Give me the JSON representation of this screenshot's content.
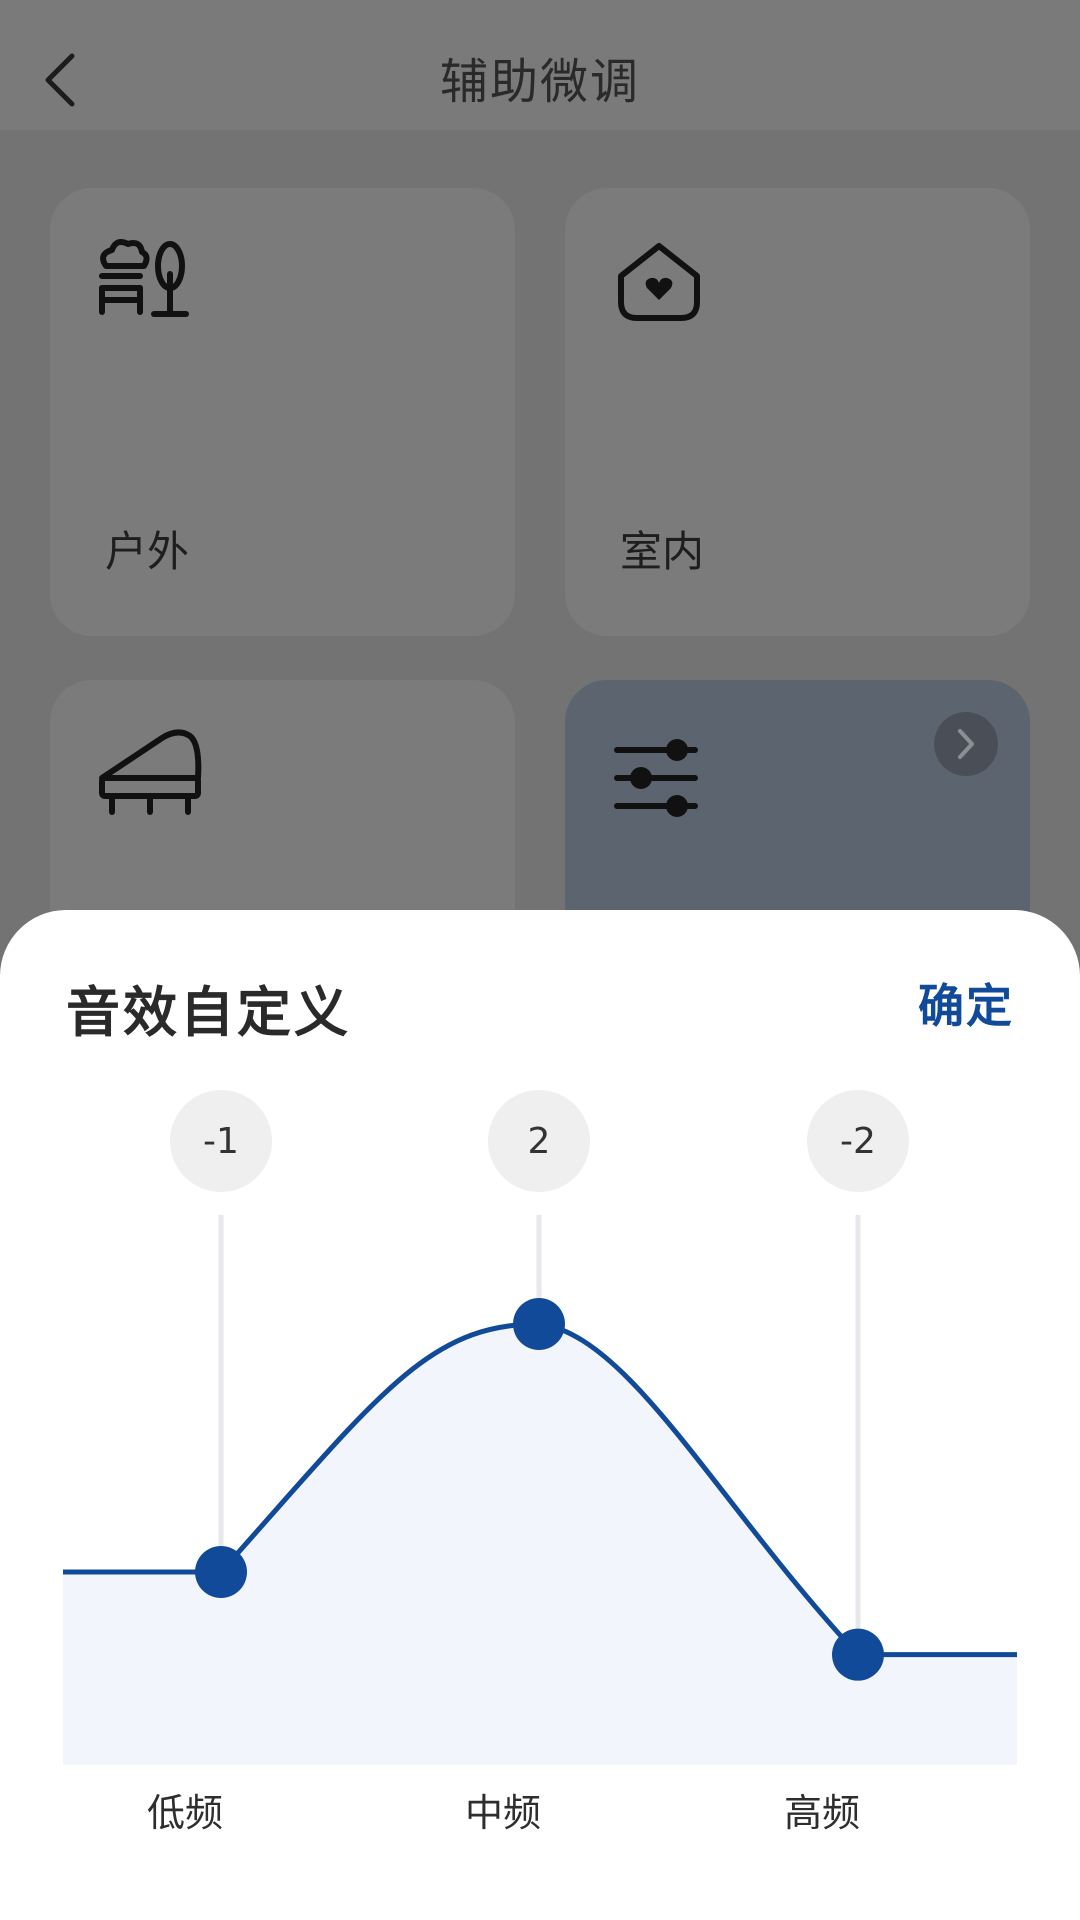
{
  "header": {
    "title": "辅助微调",
    "back_icon": "chevron-left-icon"
  },
  "cards": [
    {
      "label": "户外",
      "icon": "outdoor-bench-tree-icon"
    },
    {
      "label": "室内",
      "icon": "home-heart-icon"
    },
    {
      "label": "",
      "icon": "piano-icon"
    },
    {
      "label": "",
      "icon": "sliders-icon",
      "selected": true,
      "arrow_icon": "chevron-right-icon"
    }
  ],
  "sheet": {
    "title": "音效自定义",
    "confirm_label": "确定"
  },
  "equalizer": {
    "accent": "#104a99",
    "bands": [
      {
        "label": "低频",
        "value": -1,
        "value_text": "-1"
      },
      {
        "label": "中频",
        "value": 2,
        "value_text": "2"
      },
      {
        "label": "高频",
        "value": -2,
        "value_text": "-2"
      }
    ],
    "range": [
      -3,
      3
    ]
  }
}
